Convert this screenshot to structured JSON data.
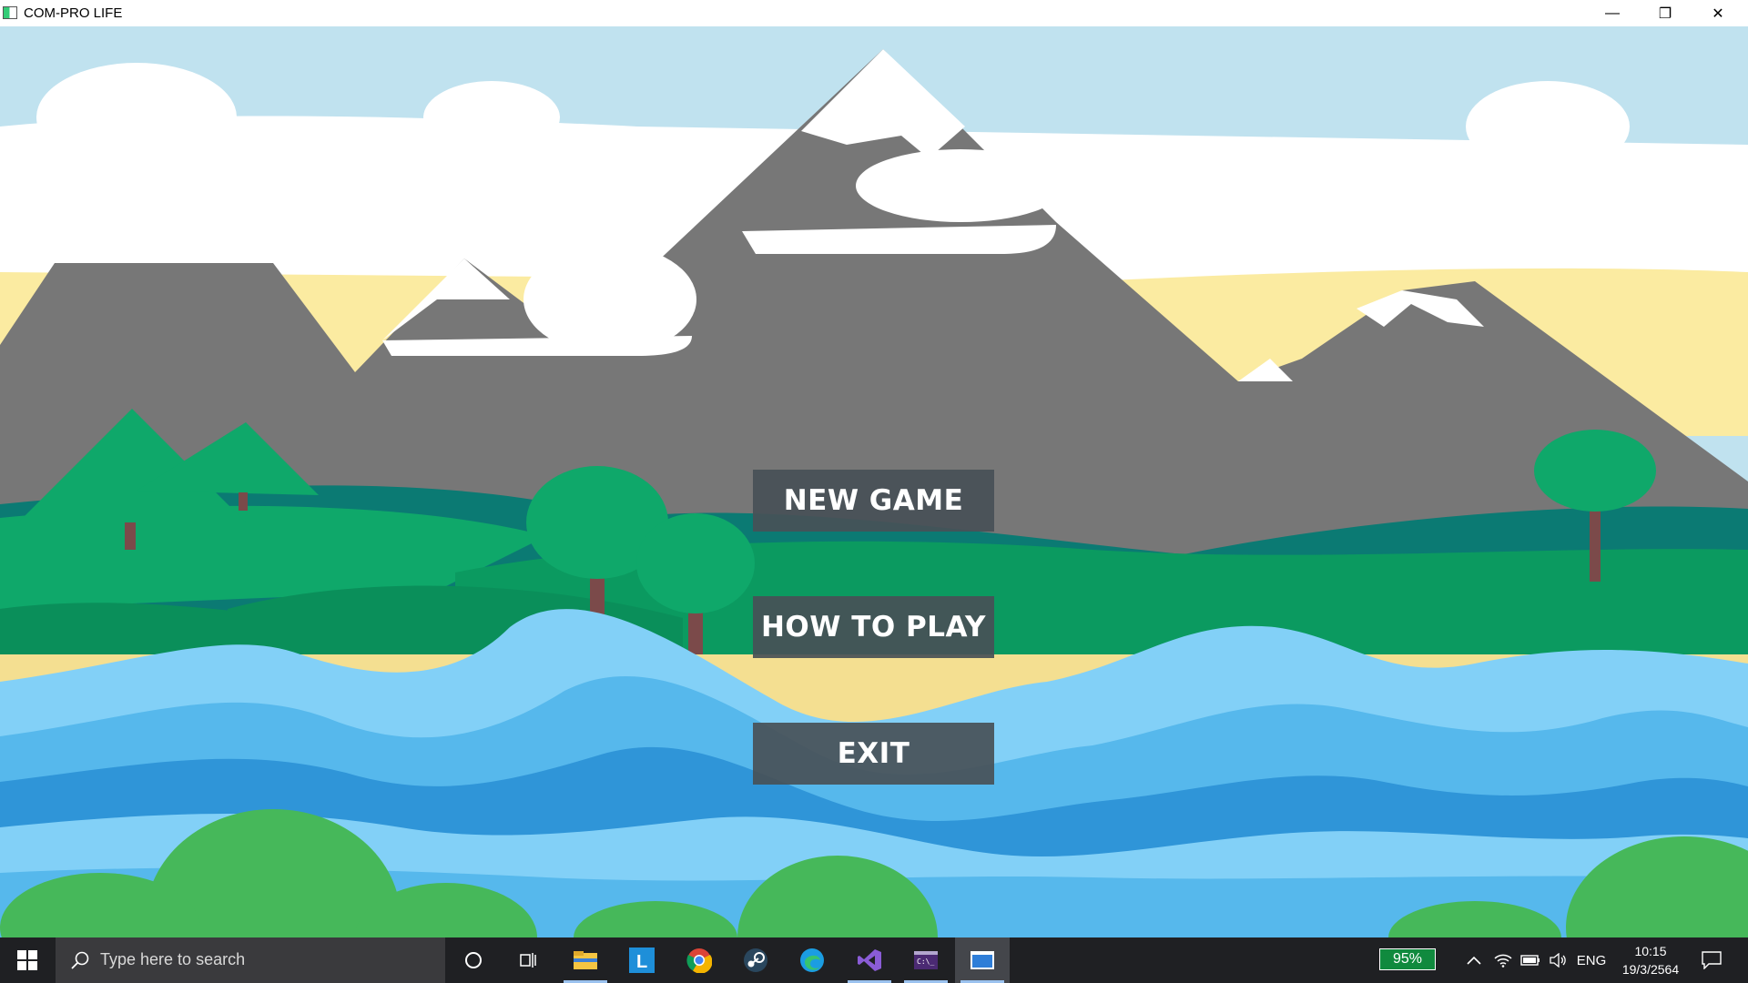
{
  "window": {
    "title": "COM-PRO LIFE",
    "controls": {
      "minimize": "—",
      "restore": "❐",
      "close": "✕"
    }
  },
  "menu": {
    "new_game": "NEW GAME",
    "how_to_play": "HOW TO PLAY",
    "exit": "EXIT"
  },
  "taskbar": {
    "search_placeholder": "Type here to search",
    "pinned_apps": [
      "cortana-icon",
      "task-view-icon",
      "file-explorer-icon",
      "launcher-l-icon",
      "chrome-icon",
      "steam-icon",
      "edge-icon",
      "visual-studio-icon",
      "terminal-icon",
      "game-window-icon"
    ],
    "battery_percent": "95%",
    "language": "ENG",
    "time": "10:15",
    "date": "19/3/2564"
  },
  "colors": {
    "sky": "#c0e2ef",
    "sand": "#fbeba1",
    "mountain": "#777777",
    "snow": "#ffffff",
    "grass": "#0fa86a",
    "water": "#82d0f7",
    "button": "#485057"
  }
}
